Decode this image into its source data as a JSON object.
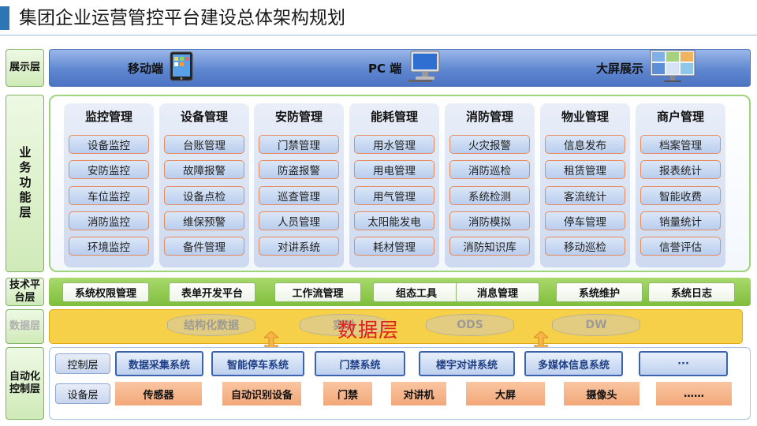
{
  "title": "集团企业运营管控平台建设总体架构规划",
  "layers": {
    "display": "展示层",
    "business": "业务功能层",
    "tech": "技术平台层",
    "data": "数据层",
    "automation": "自动化控制层"
  },
  "display_items": [
    {
      "label": "移动端",
      "icon": "tablet-icon"
    },
    {
      "label": "PC 端",
      "icon": "pc-icon"
    },
    {
      "label": "大屏展示",
      "icon": "big-screen-icon"
    }
  ],
  "business_modules": [
    {
      "title": "监控管理",
      "items": [
        "设备监控",
        "安防监控",
        "车位监控",
        "消防监控",
        "环境监控"
      ]
    },
    {
      "title": "设备管理",
      "items": [
        "台账管理",
        "故障报警",
        "设备点检",
        "维保预警",
        "备件管理"
      ]
    },
    {
      "title": "安防管理",
      "items": [
        "门禁管理",
        "防盗报警",
        "巡查管理",
        "人员管理",
        "对讲系统"
      ]
    },
    {
      "title": "能耗管理",
      "items": [
        "用水管理",
        "用电管理",
        "用气管理",
        "太阳能发电",
        "耗材管理"
      ]
    },
    {
      "title": "消防管理",
      "items": [
        "火灾报警",
        "消防巡检",
        "系统检测",
        "消防模拟",
        "消防知识库"
      ]
    },
    {
      "title": "物业管理",
      "items": [
        "信息发布",
        "租赁管理",
        "客流统计",
        "停车管理",
        "移动巡检"
      ]
    },
    {
      "title": "商户管理",
      "items": [
        "档案管理",
        "报表统计",
        "智能收费",
        "销量统计",
        "信誉评估"
      ]
    }
  ],
  "tech_items": [
    "系统权限管理",
    "表单开发平台",
    "工作流管理",
    "组态工具",
    "消息管理",
    "系统维护",
    "系统日志"
  ],
  "data_items": [
    "结构化数据",
    "实时",
    "ODS",
    "DW"
  ],
  "data_overlay_label": "数据层",
  "automation": {
    "control_label": "控制层",
    "device_label": "设备层",
    "control_items": [
      "数据采集系统",
      "智能停车系统",
      "门禁系统",
      "楼宇对讲系统",
      "多媒体信息系统",
      "···"
    ],
    "device_items": [
      "传感器",
      "自动识别设备",
      "门禁",
      "对讲机",
      "大屏",
      "摄像头",
      "……"
    ]
  },
  "colors": {
    "accent": "#2e75b6",
    "display_band": "#5f86d0",
    "tech_band": "#7fbd3c",
    "data_band": "#f4c828",
    "item_border": "#e58a5c",
    "control_border": "#3b63b0",
    "device_fill": "#f2a878",
    "overlay_text": "#e02020"
  }
}
